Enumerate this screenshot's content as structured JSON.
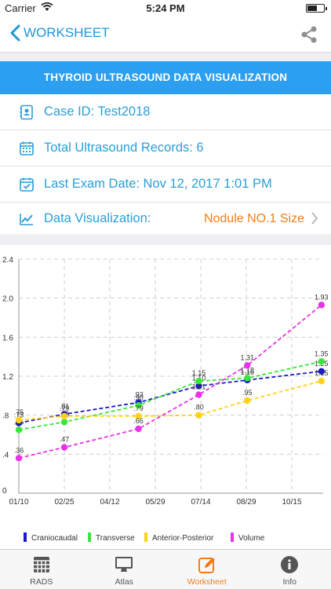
{
  "status": {
    "carrier": "Carrier",
    "time": "5:24 PM"
  },
  "nav": {
    "back_label": "WORKSHEET"
  },
  "banner": {
    "title": "THYROID ULTRASOUND DATA VISUALIZATION"
  },
  "info": {
    "case_id": "Case ID: Test2018",
    "total_records": "Total Ultrasound Records: 6",
    "last_exam": "Last Exam Date: Nov 12, 2017  1:01 PM",
    "viz_label": "Data Visualization:",
    "viz_value": "Nodule NO.1 Size"
  },
  "colors": {
    "accent": "#2a9fd8",
    "banner": "#2d9ff0",
    "highlight": "#f07d1a"
  },
  "chart_data": {
    "type": "line",
    "x_tick_labels": [
      "01/10",
      "02/25",
      "04/12",
      "05/29",
      "07/14",
      "08/29",
      "10/15"
    ],
    "y_tick_labels": [
      "0",
      ".4",
      ".8",
      "1.2",
      "1.6",
      "2.0",
      "2.4"
    ],
    "x_dates": [
      "01/10",
      "02/25",
      "05/11",
      "07/11",
      "08/29",
      "11/12"
    ],
    "ylim": [
      0,
      2.4
    ],
    "grid": true,
    "legend_position": "bottom",
    "series": [
      {
        "name": "Craniocaudal",
        "color": "#1a1acc",
        "values": [
          0.72,
          0.81,
          0.93,
          1.1,
          1.16,
          1.25
        ],
        "labels": [
          ".73",
          ".81",
          ".93",
          "1.10",
          "1.16",
          "1.25"
        ]
      },
      {
        "name": "Transverse",
        "color": "#39e639",
        "values": [
          0.65,
          0.73,
          0.9,
          1.15,
          1.18,
          1.35
        ],
        "labels": [
          ".65",
          ".73",
          ".90",
          "1.15",
          "1.18",
          "1.35"
        ]
      },
      {
        "name": "Anterior-Posterior",
        "color": "#ffd21a",
        "values": [
          0.75,
          0.79,
          0.79,
          0.8,
          0.95,
          1.15
        ],
        "labels": [
          ".75",
          ".79",
          ".79",
          ".80",
          ".95",
          "1.15"
        ]
      },
      {
        "name": "Volume",
        "color": "#e833e8",
        "values": [
          0.36,
          0.47,
          0.66,
          1.01,
          1.31,
          1.93
        ],
        "labels": [
          ".36",
          ".47",
          ".66",
          "1.01",
          "1.31",
          "1.93"
        ]
      }
    ]
  },
  "tabs": [
    {
      "label": "RADS",
      "icon": "grid-icon"
    },
    {
      "label": "Atlas",
      "icon": "monitor-icon"
    },
    {
      "label": "Worksheet",
      "icon": "edit-icon"
    },
    {
      "label": "Info",
      "icon": "info-icon"
    }
  ]
}
